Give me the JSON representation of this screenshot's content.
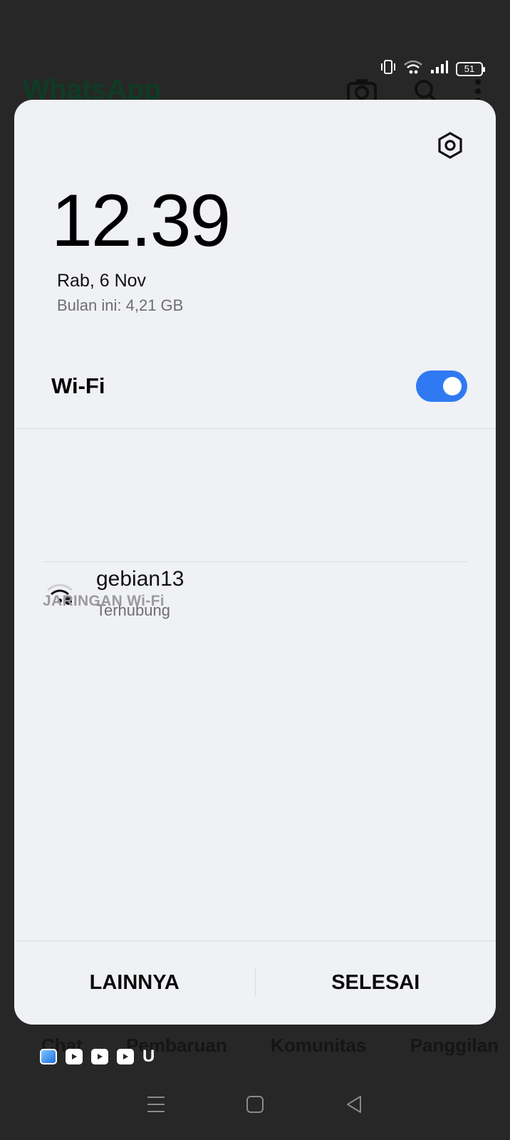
{
  "background_app": {
    "title": "WhatsApp",
    "tabs": [
      "Chat",
      "Pembaruan",
      "Komunitas",
      "Panggilan"
    ],
    "icons": [
      "camera-icon",
      "search-icon",
      "more-vert-icon"
    ],
    "brand_color": "#0f3b26"
  },
  "status_bar": {
    "icons": [
      "vibrate-icon",
      "wifi-icon",
      "signal-icon"
    ],
    "battery": "51"
  },
  "panel": {
    "clock": "12.39",
    "date": "Rab, 6 Nov",
    "usage": "Bulan ini: 4,21 GB",
    "wifi_label": "Wi-Fi",
    "wifi_enabled": true,
    "accent_color": "#2f7af2",
    "connected_network": {
      "name": "gebian13",
      "status": "Terhubung"
    },
    "section_header": "JARINGAN Wi-Fi",
    "buttons": {
      "more": "LAINNYA",
      "done": "SELESAI"
    }
  },
  "notification_icons": [
    "app-icon",
    "youtube-icon",
    "youtube-icon",
    "youtube-icon",
    "u-icon"
  ],
  "notif_u_label": "U",
  "nav_bar": [
    "menu-icon",
    "home-icon",
    "back-icon"
  ]
}
